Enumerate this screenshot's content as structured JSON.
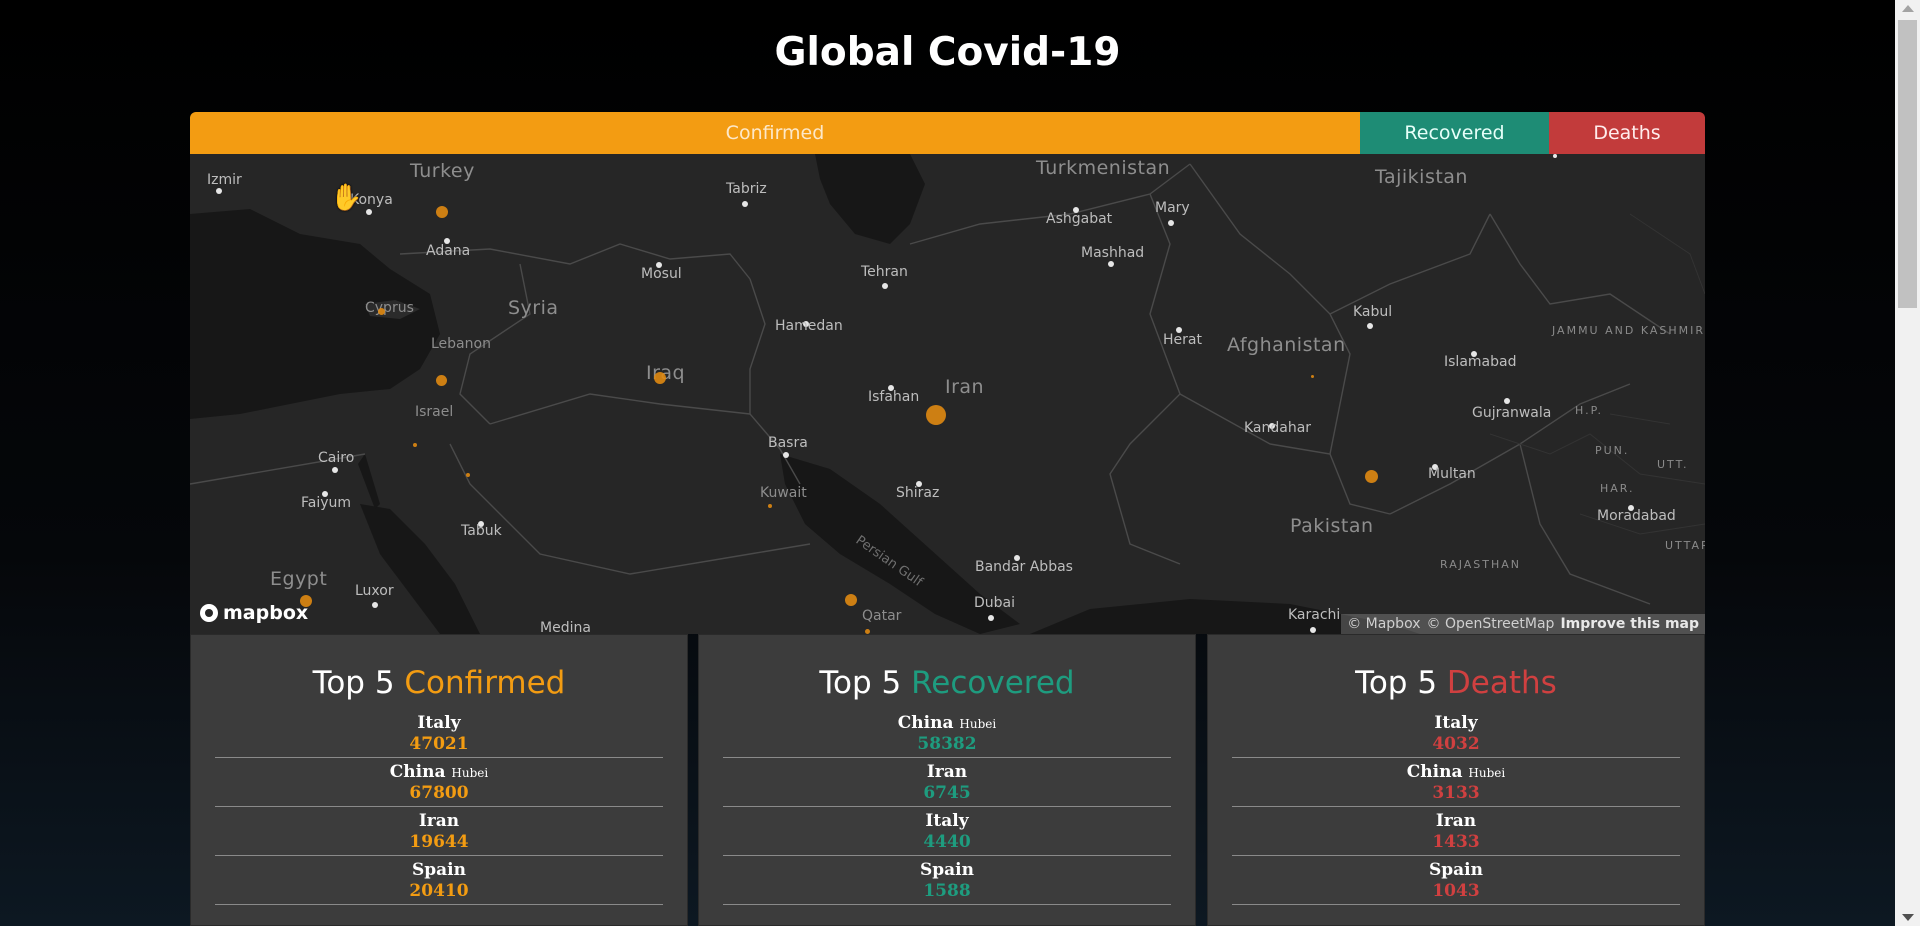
{
  "page": {
    "title": "Global Covid-19"
  },
  "tabs": [
    {
      "label": "Confirmed",
      "color": "#f39c12"
    },
    {
      "label": "Recovered",
      "color": "#1e8c75"
    },
    {
      "label": "Deaths",
      "color": "#c23b3b"
    }
  ],
  "map": {
    "countries": [
      "Turkey",
      "Turkmenistan",
      "Tajikistan",
      "Syria",
      "Cyprus",
      "Lebanon",
      "Iraq",
      "Iran",
      "Afghanistan",
      "Israel",
      "Egypt",
      "Kuwait",
      "Pakistan",
      "Qatar"
    ],
    "cities": [
      "Izmir",
      "Konya",
      "Adana",
      "Tabriz",
      "Mosul",
      "Ashgabat",
      "Mary",
      "Mashhad",
      "Tehran",
      "Hamedan",
      "Herat",
      "Kabul",
      "Islamabad",
      "Gujranwala",
      "Isfahan",
      "Basra",
      "Kandahar",
      "Multan",
      "Cairo",
      "Faiyum",
      "Tabuk",
      "Shiraz",
      "Moradabad",
      "Bandar Abbas",
      "Dubai",
      "Luxor",
      "Karachi",
      "Medina"
    ],
    "regions": [
      "JAMMU AND KASHMIR",
      "H.P.",
      "PUN.",
      "UTT.",
      "HAR.",
      "RAJASTHAN",
      "UTTAR PRADESH"
    ],
    "water": "Persian Gulf",
    "logo": "mapbox",
    "attribution": {
      "mapbox": "© Mapbox",
      "osm": "© OpenStreetMap",
      "improve": "Improve this map"
    }
  },
  "panels": [
    {
      "prefix": "Top 5",
      "category": "Confirmed",
      "color": "#f39c12",
      "items": [
        {
          "country": "Italy",
          "region": "",
          "value": "47021"
        },
        {
          "country": "China",
          "region": "Hubei",
          "value": "67800"
        },
        {
          "country": "Iran",
          "region": "",
          "value": "19644"
        },
        {
          "country": "Spain",
          "region": "",
          "value": "20410"
        }
      ]
    },
    {
      "prefix": "Top 5",
      "category": "Recovered",
      "color": "#1e9c7f",
      "items": [
        {
          "country": "China",
          "region": "Hubei",
          "value": "58382"
        },
        {
          "country": "Iran",
          "region": "",
          "value": "6745"
        },
        {
          "country": "Italy",
          "region": "",
          "value": "4440"
        },
        {
          "country": "Spain",
          "region": "",
          "value": "1588"
        }
      ]
    },
    {
      "prefix": "Top 5",
      "category": "Deaths",
      "color": "#d04040",
      "items": [
        {
          "country": "Italy",
          "region": "",
          "value": "4032"
        },
        {
          "country": "China",
          "region": "Hubei",
          "value": "3133"
        },
        {
          "country": "Iran",
          "region": "",
          "value": "1433"
        },
        {
          "country": "Spain",
          "region": "",
          "value": "1043"
        }
      ]
    }
  ]
}
